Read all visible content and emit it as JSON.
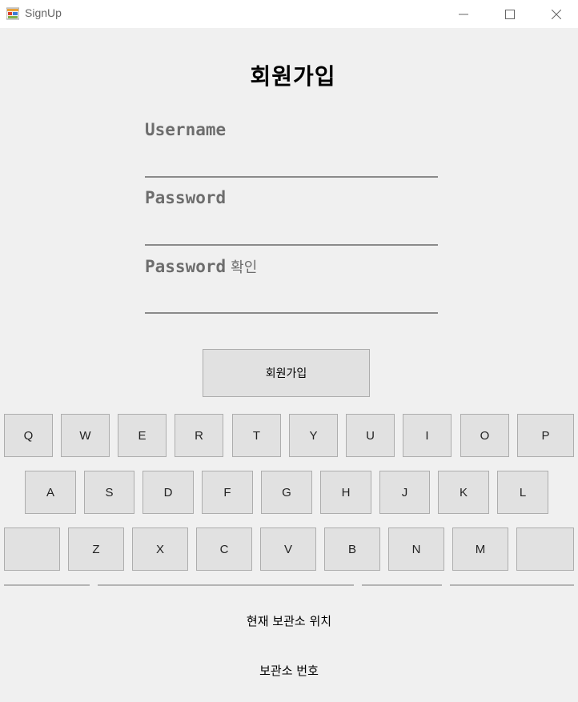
{
  "window": {
    "title": "SignUp",
    "icon": "app-window-icon"
  },
  "form": {
    "title": "회원가입",
    "username_label": "Username",
    "password_label": "Password",
    "confirm_label": "Password",
    "confirm_suffix": "확인",
    "username_value": "",
    "password_value": "",
    "confirm_value": "",
    "submit_label": "회원가입"
  },
  "keyboard": {
    "row1": [
      "Q",
      "W",
      "E",
      "R",
      "T",
      "Y",
      "U",
      "I",
      "O",
      "P"
    ],
    "row2": [
      "A",
      "S",
      "D",
      "F",
      "G",
      "H",
      "J",
      "K",
      "L"
    ],
    "row3": [
      "",
      "Z",
      "X",
      "C",
      "V",
      "B",
      "N",
      "M",
      ""
    ]
  },
  "footer": {
    "location_label": "현재 보관소 위치",
    "locker_number_label": "보관소 번호"
  }
}
